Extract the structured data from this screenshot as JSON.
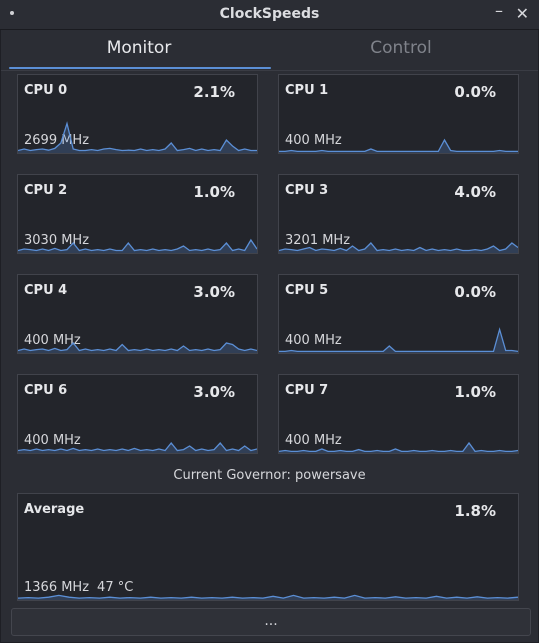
{
  "window": {
    "title": "ClockSpeeds"
  },
  "tabs": {
    "monitor": "Monitor",
    "control": "Control"
  },
  "cpus": [
    {
      "name": "CPU 0",
      "usage": "2.1%",
      "freq": "2699 MHz",
      "history": [
        0.05,
        0.1,
        0.05,
        0.08,
        0.1,
        0.06,
        0.12,
        0.3,
        0.95,
        0.1,
        0.05,
        0.05,
        0.08,
        0.05,
        0.1,
        0.12,
        0.08,
        0.05,
        0.06,
        0.05,
        0.1,
        0.05,
        0.08,
        0.05,
        0.1,
        0.3,
        0.05,
        0.08,
        0.12,
        0.05,
        0.1,
        0.05,
        0.08,
        0.05,
        0.4,
        0.2,
        0.05,
        0.1,
        0.05,
        0.05
      ]
    },
    {
      "name": "CPU 1",
      "usage": "0.0%",
      "freq": "400 MHz",
      "history": [
        0.02,
        0.02,
        0.05,
        0.02,
        0.02,
        0.02,
        0.02,
        0.05,
        0.02,
        0.02,
        0.02,
        0.02,
        0.02,
        0.02,
        0.02,
        0.1,
        0.02,
        0.02,
        0.02,
        0.02,
        0.02,
        0.02,
        0.02,
        0.02,
        0.02,
        0.02,
        0.02,
        0.4,
        0.05,
        0.02,
        0.02,
        0.02,
        0.02,
        0.02,
        0.02,
        0.02,
        0.05,
        0.02,
        0.02,
        0.02
      ]
    },
    {
      "name": "CPU 2",
      "usage": "1.0%",
      "freq": "3030 MHz",
      "history": [
        0.05,
        0.1,
        0.08,
        0.05,
        0.1,
        0.05,
        0.12,
        0.05,
        0.08,
        0.3,
        0.05,
        0.1,
        0.05,
        0.08,
        0.05,
        0.1,
        0.05,
        0.05,
        0.3,
        0.05,
        0.08,
        0.05,
        0.1,
        0.05,
        0.08,
        0.05,
        0.1,
        0.2,
        0.05,
        0.08,
        0.05,
        0.1,
        0.05,
        0.08,
        0.3,
        0.05,
        0.1,
        0.05,
        0.4,
        0.1
      ]
    },
    {
      "name": "CPU 3",
      "usage": "4.0%",
      "freq": "3201 MHz",
      "history": [
        0.05,
        0.1,
        0.08,
        0.05,
        0.1,
        0.15,
        0.05,
        0.1,
        0.08,
        0.05,
        0.12,
        0.05,
        0.2,
        0.05,
        0.1,
        0.3,
        0.05,
        0.08,
        0.05,
        0.1,
        0.05,
        0.08,
        0.05,
        0.15,
        0.05,
        0.1,
        0.05,
        0.08,
        0.05,
        0.1,
        0.05,
        0.05,
        0.08,
        0.05,
        0.1,
        0.2,
        0.05,
        0.1,
        0.3,
        0.15
      ]
    },
    {
      "name": "CPU 4",
      "usage": "3.0%",
      "freq": "400 MHz",
      "history": [
        0.05,
        0.1,
        0.05,
        0.08,
        0.1,
        0.05,
        0.12,
        0.05,
        0.08,
        0.3,
        0.05,
        0.1,
        0.05,
        0.08,
        0.05,
        0.1,
        0.05,
        0.25,
        0.05,
        0.08,
        0.05,
        0.1,
        0.05,
        0.08,
        0.05,
        0.1,
        0.05,
        0.2,
        0.05,
        0.08,
        0.05,
        0.1,
        0.05,
        0.08,
        0.3,
        0.25,
        0.1,
        0.05,
        0.1,
        0.05
      ]
    },
    {
      "name": "CPU 5",
      "usage": "0.0%",
      "freq": "400 MHz",
      "history": [
        0.02,
        0.02,
        0.05,
        0.02,
        0.02,
        0.02,
        0.02,
        0.02,
        0.02,
        0.02,
        0.02,
        0.02,
        0.02,
        0.02,
        0.02,
        0.02,
        0.02,
        0.02,
        0.2,
        0.02,
        0.02,
        0.02,
        0.02,
        0.02,
        0.02,
        0.02,
        0.02,
        0.02,
        0.02,
        0.02,
        0.02,
        0.02,
        0.02,
        0.02,
        0.02,
        0.02,
        0.75,
        0.05,
        0.05,
        0.02
      ]
    },
    {
      "name": "CPU 6",
      "usage": "3.0%",
      "freq": "400 MHz",
      "history": [
        0.05,
        0.08,
        0.05,
        0.1,
        0.05,
        0.08,
        0.05,
        0.1,
        0.05,
        0.12,
        0.05,
        0.08,
        0.05,
        0.1,
        0.05,
        0.08,
        0.05,
        0.1,
        0.05,
        0.12,
        0.05,
        0.08,
        0.05,
        0.1,
        0.05,
        0.3,
        0.05,
        0.08,
        0.2,
        0.05,
        0.1,
        0.05,
        0.08,
        0.3,
        0.05,
        0.1,
        0.05,
        0.2,
        0.05,
        0.1
      ]
    },
    {
      "name": "CPU 7",
      "usage": "1.0%",
      "freq": "400 MHz",
      "history": [
        0.02,
        0.05,
        0.02,
        0.02,
        0.05,
        0.02,
        0.02,
        0.1,
        0.02,
        0.02,
        0.05,
        0.02,
        0.02,
        0.08,
        0.02,
        0.02,
        0.05,
        0.02,
        0.02,
        0.1,
        0.02,
        0.02,
        0.05,
        0.02,
        0.02,
        0.05,
        0.02,
        0.02,
        0.05,
        0.02,
        0.02,
        0.3,
        0.02,
        0.05,
        0.02,
        0.02,
        0.05,
        0.02,
        0.02,
        0.05
      ]
    }
  ],
  "governor": "Current Governor: powersave",
  "average": {
    "name": "Average",
    "usage": "1.8%",
    "freq": "1366 MHz",
    "temp": "47 °C",
    "history": [
      0.05,
      0.08,
      0.05,
      0.1,
      0.2,
      0.1,
      0.05,
      0.08,
      0.05,
      0.1,
      0.05,
      0.08,
      0.05,
      0.1,
      0.05,
      0.08,
      0.05,
      0.1,
      0.05,
      0.08,
      0.05,
      0.1,
      0.05,
      0.08,
      0.05,
      0.15,
      0.05,
      0.2,
      0.05,
      0.08,
      0.05,
      0.1,
      0.05,
      0.2,
      0.05,
      0.08,
      0.05,
      0.12,
      0.05,
      0.08,
      0.05,
      0.15,
      0.05,
      0.1,
      0.05,
      0.12,
      0.05,
      0.08,
      0.05,
      0.1
    ]
  },
  "bottom": {
    "more": "..."
  },
  "colors": {
    "accent": "#5b8fd6",
    "bg": "#2b2d34",
    "panel": "#23252b"
  }
}
